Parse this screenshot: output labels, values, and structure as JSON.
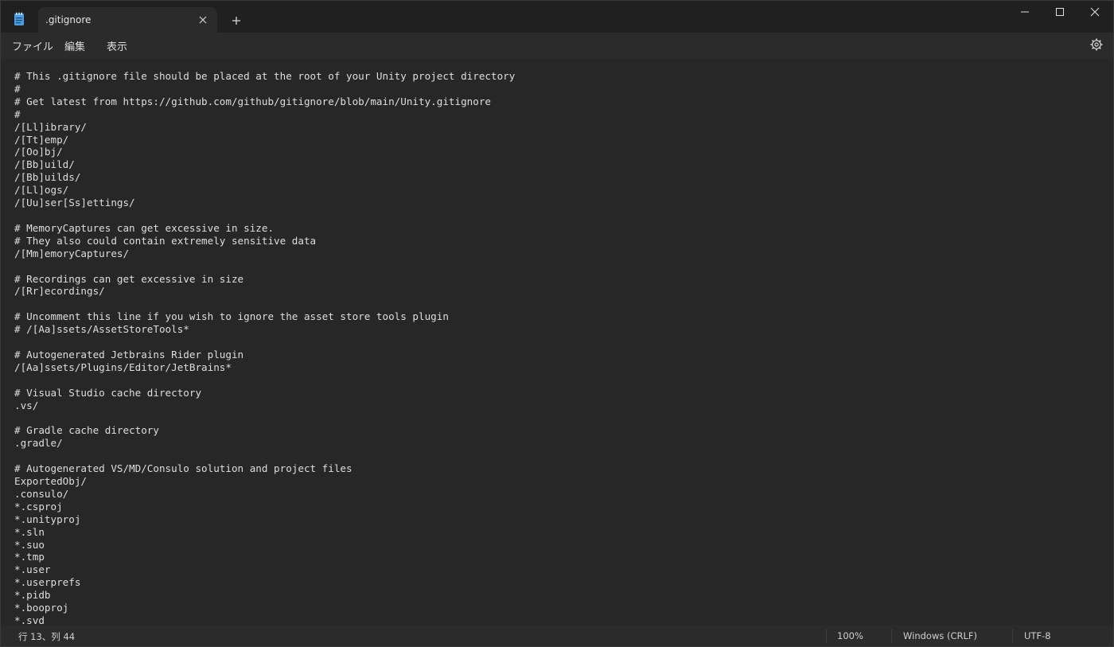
{
  "window": {
    "tab_title": ".gitignore",
    "new_tab_label": "+"
  },
  "menu": {
    "file": "ファイル",
    "edit": "編集",
    "view": "表示"
  },
  "icons": {
    "app": "notepad-icon",
    "close_tab": "close-icon",
    "new_tab": "plus-icon",
    "minimize": "minimize-icon",
    "maximize": "maximize-icon",
    "close_window": "close-icon",
    "settings": "gear-icon"
  },
  "colors": {
    "background": "#272727",
    "titlebar": "#202020",
    "tab": "#2b2b2b",
    "text": "#dedede"
  },
  "editor": {
    "content": "# This .gitignore file should be placed at the root of your Unity project directory\n#\n# Get latest from https://github.com/github/gitignore/blob/main/Unity.gitignore\n#\n/[Ll]ibrary/\n/[Tt]emp/\n/[Oo]bj/\n/[Bb]uild/\n/[Bb]uilds/\n/[Ll]ogs/\n/[Uu]ser[Ss]ettings/\n\n# MemoryCaptures can get excessive in size.\n# They also could contain extremely sensitive data\n/[Mm]emoryCaptures/\n\n# Recordings can get excessive in size\n/[Rr]ecordings/\n\n# Uncomment this line if you wish to ignore the asset store tools plugin\n# /[Aa]ssets/AssetStoreTools*\n\n# Autogenerated Jetbrains Rider plugin\n/[Aa]ssets/Plugins/Editor/JetBrains*\n\n# Visual Studio cache directory\n.vs/\n\n# Gradle cache directory\n.gradle/\n\n# Autogenerated VS/MD/Consulo solution and project files\nExportedObj/\n.consulo/\n*.csproj\n*.unityproj\n*.sln\n*.suo\n*.tmp\n*.user\n*.userprefs\n*.pidb\n*.booproj\n*.svd"
  },
  "status": {
    "position": "行 13、列 44",
    "zoom": "100%",
    "line_ending": "Windows (CRLF)",
    "encoding": "UTF-8"
  }
}
